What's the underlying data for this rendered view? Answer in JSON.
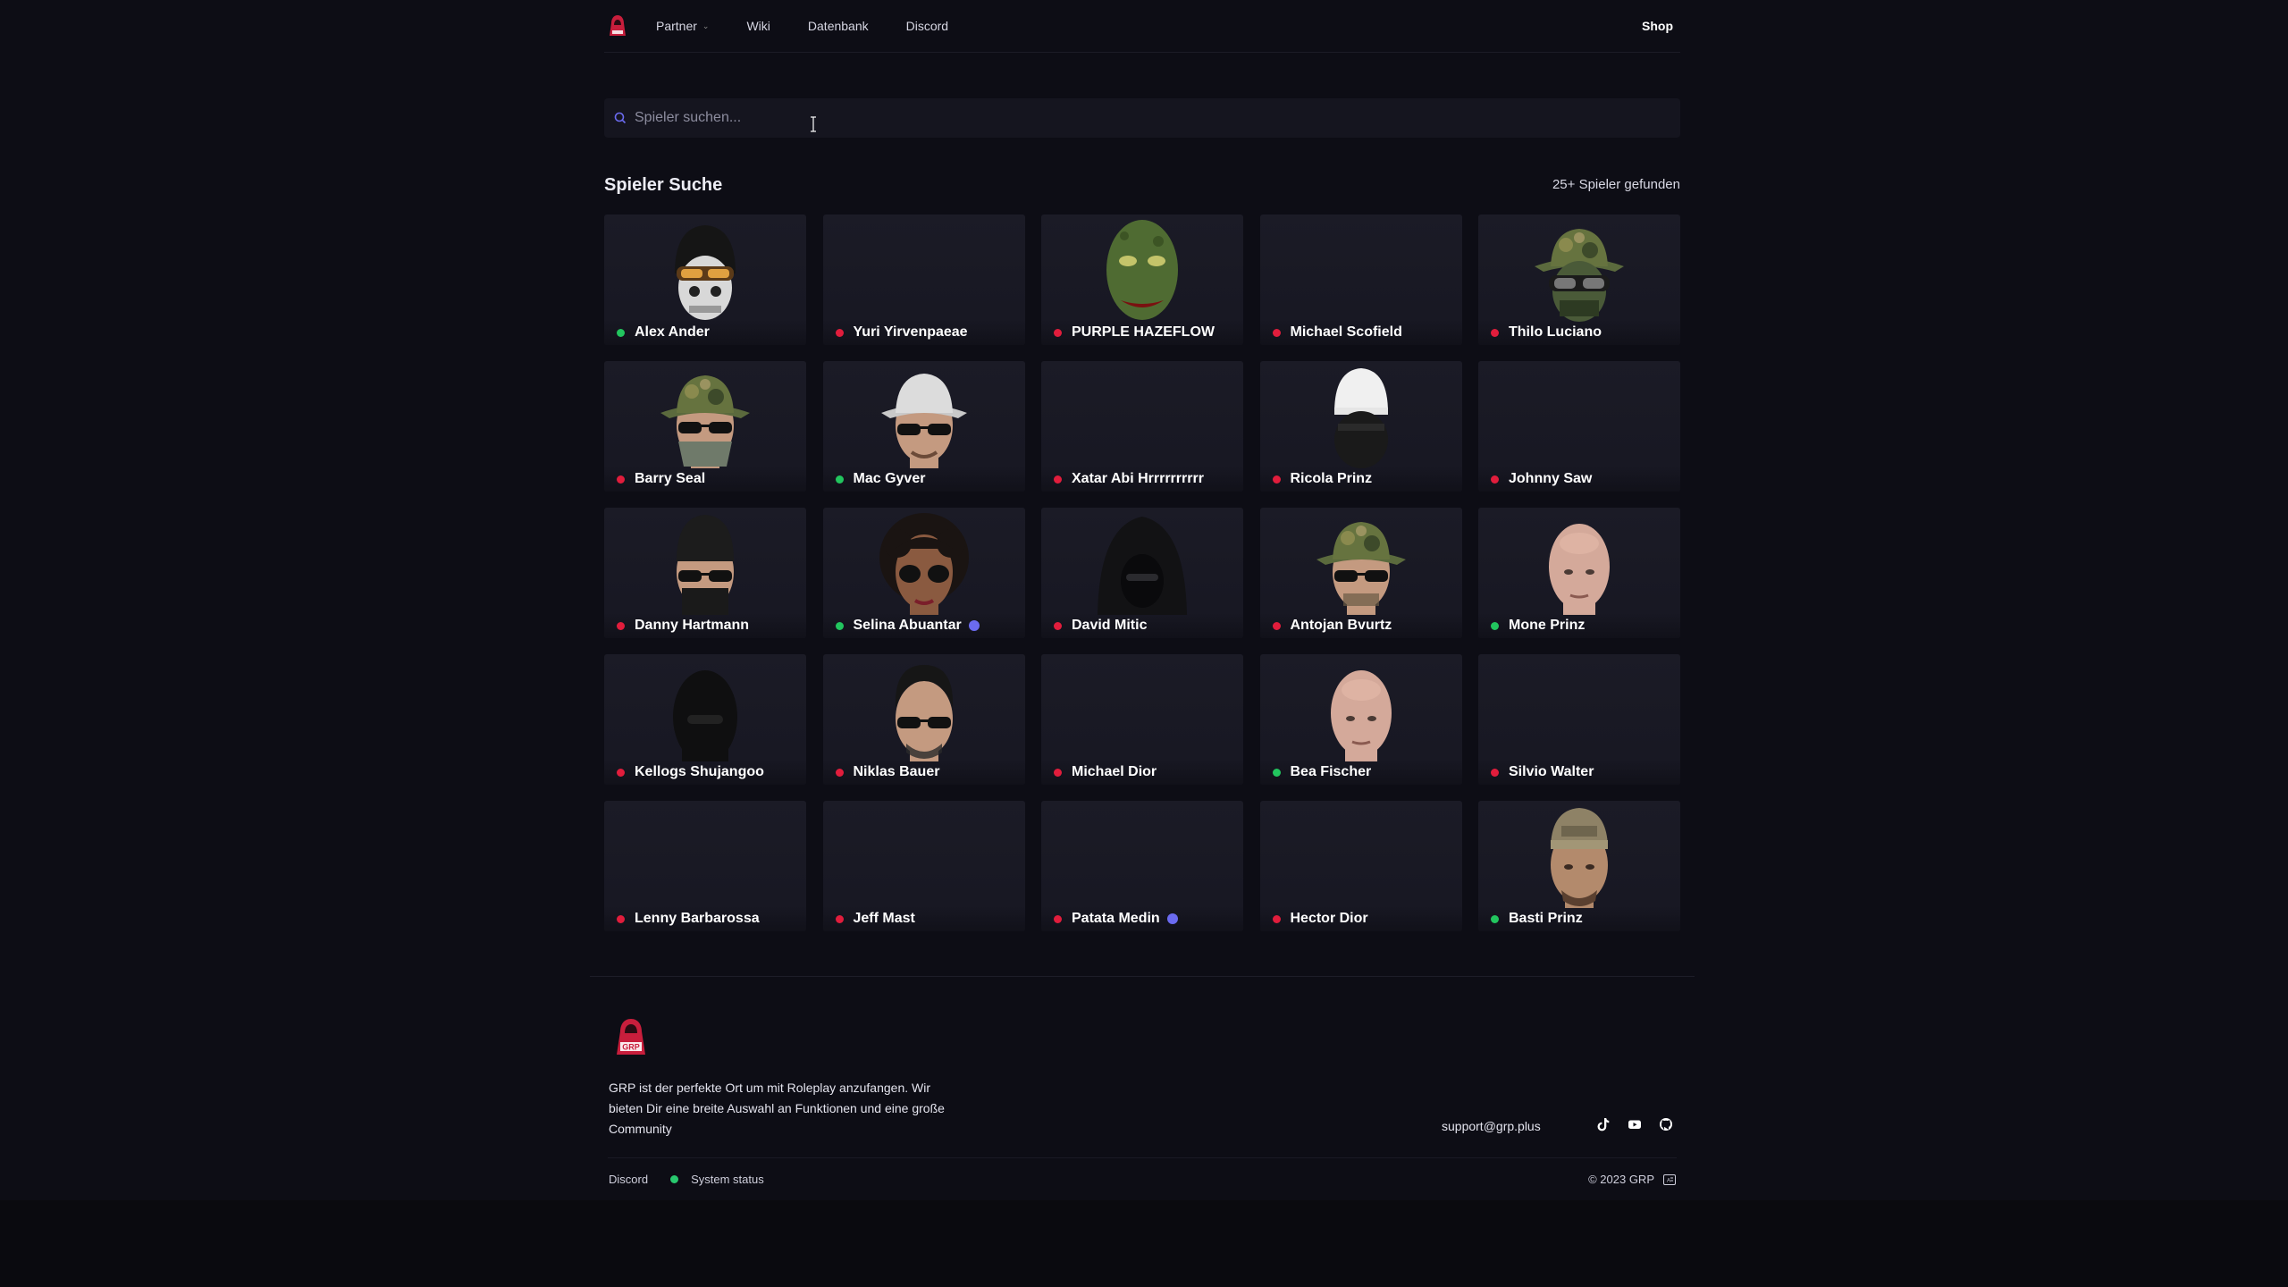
{
  "colors": {
    "online": "#22c55e",
    "offline": "#e11d3c",
    "verified": "#6b6bf0",
    "background": "#0d0d15",
    "card": "#1a1a25"
  },
  "nav": {
    "logo_icon": "grp-hoodie-logo",
    "links": [
      {
        "label": "Partner",
        "has_dropdown": true
      },
      {
        "label": "Wiki"
      },
      {
        "label": "Datenbank"
      },
      {
        "label": "Discord"
      }
    ],
    "shop_label": "Shop"
  },
  "search": {
    "placeholder": "Spieler suchen...",
    "value": ""
  },
  "section": {
    "title": "Spieler Suche",
    "count": "25+ Spieler gefunden"
  },
  "players": [
    {
      "name": "Alex Ander",
      "status": "online",
      "avatar": "skull-mask-goggles",
      "verified": false
    },
    {
      "name": "Yuri Yirvenpaeae",
      "status": "offline",
      "avatar": "none",
      "verified": false
    },
    {
      "name": "PURPLE HAZEFLOW",
      "status": "offline",
      "avatar": "green-alien-mask",
      "verified": false
    },
    {
      "name": "Michael Scofield",
      "status": "offline",
      "avatar": "none",
      "verified": false
    },
    {
      "name": "Thilo Luciano",
      "status": "offline",
      "avatar": "camo-hat-goggles",
      "verified": false
    },
    {
      "name": "Barry Seal",
      "status": "offline",
      "avatar": "camo-hat-bandana",
      "verified": false
    },
    {
      "name": "Mac Gyver",
      "status": "online",
      "avatar": "white-hat-sunglasses",
      "verified": false
    },
    {
      "name": "Xatar Abi Hrrrrrrrrrr",
      "status": "offline",
      "avatar": "none",
      "verified": false
    },
    {
      "name": "Ricola Prinz",
      "status": "offline",
      "avatar": "white-cap-mask",
      "verified": false
    },
    {
      "name": "Johnny Saw",
      "status": "offline",
      "avatar": "none",
      "verified": false
    },
    {
      "name": "Danny Hartmann",
      "status": "offline",
      "avatar": "beanie-sunglasses",
      "verified": false
    },
    {
      "name": "Selina Abuantar",
      "status": "online",
      "avatar": "curly-hair-sunglasses",
      "verified": true
    },
    {
      "name": "David Mitic",
      "status": "offline",
      "avatar": "dark-hood",
      "verified": false
    },
    {
      "name": "Antojan Bvurtz",
      "status": "offline",
      "avatar": "camo-hat-sunglasses",
      "verified": false
    },
    {
      "name": "Mone Prinz",
      "status": "online",
      "avatar": "bald-head",
      "verified": false
    },
    {
      "name": "Kellogs Shujangoo",
      "status": "offline",
      "avatar": "black-balaclava",
      "verified": false
    },
    {
      "name": "Niklas Bauer",
      "status": "offline",
      "avatar": "dark-hair-sunglasses",
      "verified": false
    },
    {
      "name": "Michael Dior",
      "status": "offline",
      "avatar": "none",
      "verified": false
    },
    {
      "name": "Bea Fischer",
      "status": "online",
      "avatar": "bald-head",
      "verified": false
    },
    {
      "name": "Silvio Walter",
      "status": "offline",
      "avatar": "none",
      "verified": false
    },
    {
      "name": "Lenny Barbarossa",
      "status": "offline",
      "avatar": "none",
      "verified": false
    },
    {
      "name": "Jeff Mast",
      "status": "offline",
      "avatar": "none",
      "verified": false
    },
    {
      "name": "Patata Medin",
      "status": "offline",
      "avatar": "none",
      "verified": true
    },
    {
      "name": "Hector Dior",
      "status": "offline",
      "avatar": "none",
      "verified": false
    },
    {
      "name": "Basti Prinz",
      "status": "online",
      "avatar": "backwards-cap",
      "verified": false
    }
  ],
  "footer": {
    "logo_icon": "grp-hoodie-logo",
    "logo_text": "GRP",
    "description": "GRP ist der perfekte Ort um mit Roleplay anzufangen. Wir bieten Dir eine breite Auswahl an Funktionen und eine große Community",
    "email": "support@grp.plus",
    "socials": [
      "tiktok-icon",
      "youtube-icon",
      "github-icon"
    ],
    "discord_label": "Discord",
    "status_label": "System status",
    "copyright": "© 2023 GRP",
    "language_icon": "language-icon"
  }
}
